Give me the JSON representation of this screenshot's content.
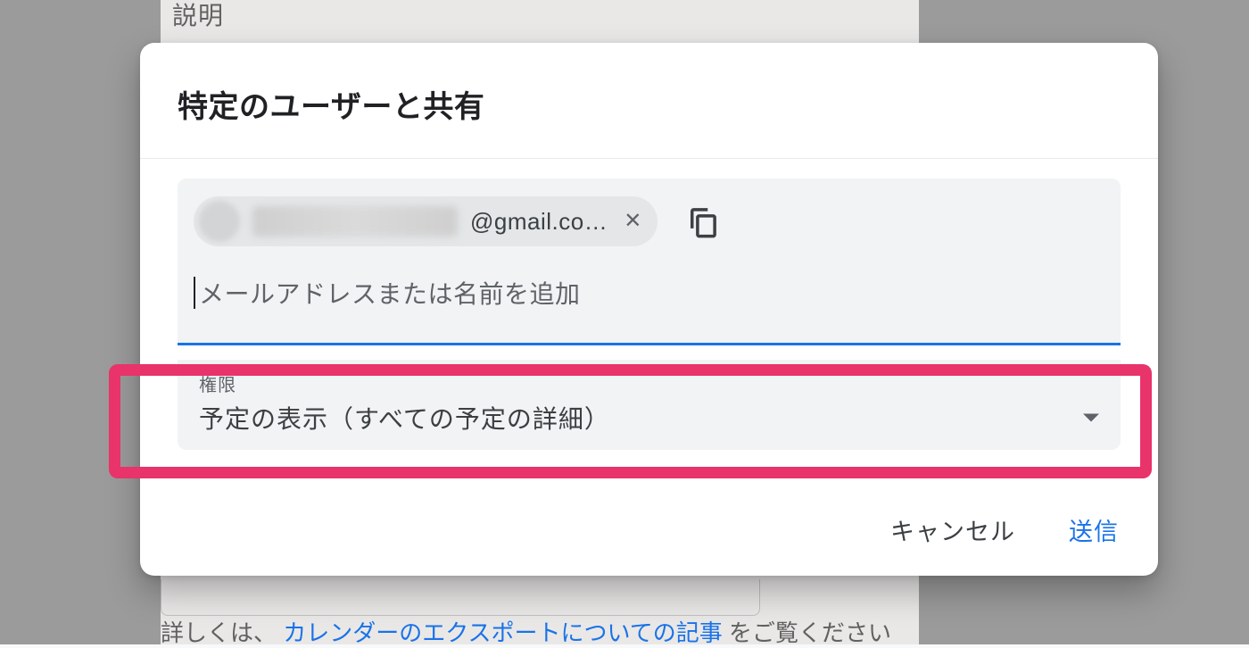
{
  "background": {
    "description_label": "説明",
    "footer_prefix": "詳しくは、",
    "footer_link": "カレンダーのエクスポートについての記事",
    "footer_suffix": "をご覧ください"
  },
  "dialog": {
    "title": "特定のユーザーと共有",
    "chip": {
      "redacted_name": "",
      "email_tail": "@gmail.co…",
      "close_glyph": "✕"
    },
    "email_input": {
      "placeholder": "メールアドレスまたは名前を追加",
      "value": ""
    },
    "permission": {
      "label": "権限",
      "value": "予定の表示（すべての予定の詳細）"
    },
    "buttons": {
      "cancel": "キャンセル",
      "submit": "送信"
    }
  },
  "colors": {
    "accent": "#1a73e8",
    "highlight": "#e8336b"
  }
}
